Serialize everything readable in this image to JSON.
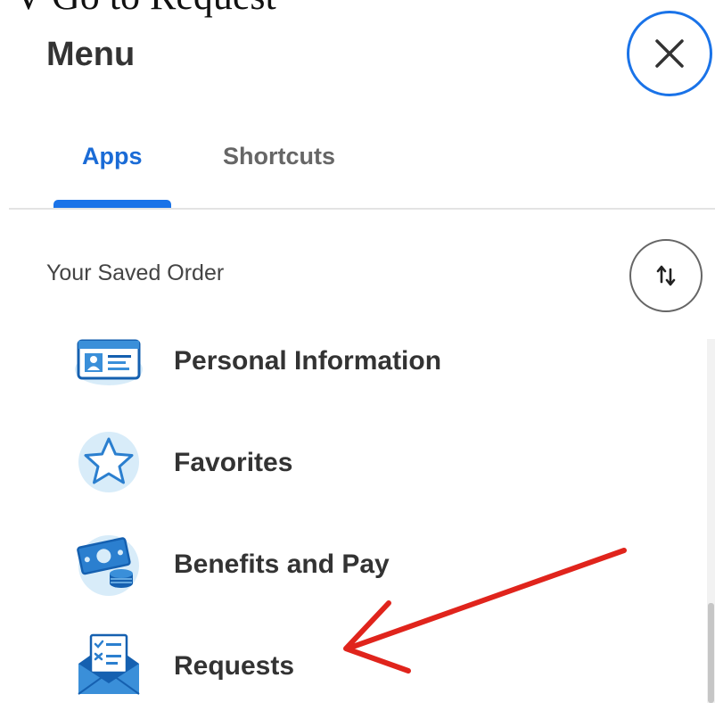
{
  "caption_fragment": "V Go to Request",
  "header": {
    "title": "Menu",
    "close_icon": "close-icon"
  },
  "tabs": [
    {
      "label": "Apps",
      "active": true
    },
    {
      "label": "Shortcuts",
      "active": false
    }
  ],
  "saved_order": {
    "label": "Your Saved Order",
    "sort_icon": "sort-icon"
  },
  "apps": [
    {
      "label": "Personal Information",
      "icon": "id-card-icon"
    },
    {
      "label": "Favorites",
      "icon": "star-icon"
    },
    {
      "label": "Benefits and Pay",
      "icon": "money-icon"
    },
    {
      "label": "Requests",
      "icon": "envelope-icon"
    }
  ],
  "colors": {
    "accent": "#1a73e8",
    "icon_bg": "#d8ecf9",
    "annotation_arrow": "#e0241c"
  }
}
